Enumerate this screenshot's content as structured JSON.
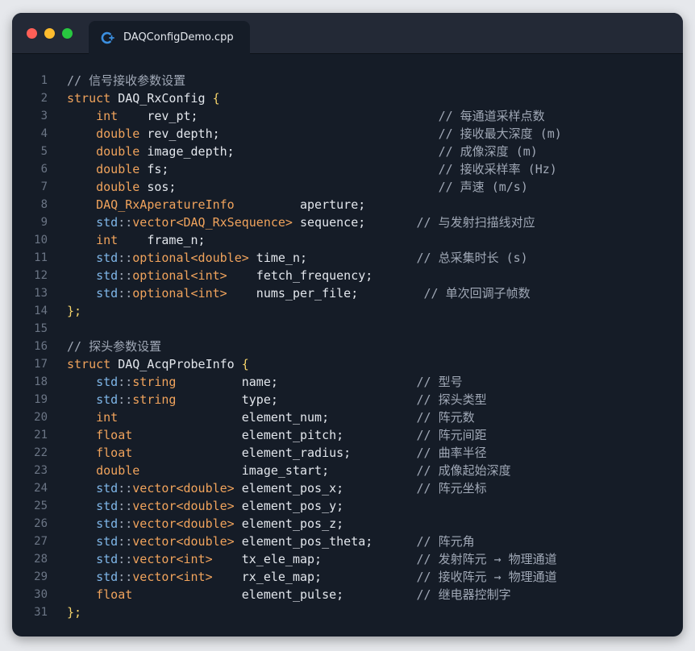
{
  "tab": {
    "title": "DAQConfigDemo.cpp",
    "icon": "cpp-file-icon"
  },
  "colors": {
    "background": "#151c27",
    "keyword": "#f0a35c",
    "namespace": "#7fb6e8",
    "comment": "#a0a8b6",
    "brace": "#f5d36a",
    "text": "#e2e6ec",
    "line_number": "#6b7585"
  },
  "lines": [
    [
      [
        "cm",
        "// 信号接收参数设置"
      ]
    ],
    [
      [
        "kw",
        "struct "
      ],
      [
        "id",
        "DAQ_RxConfig "
      ],
      [
        "br",
        "{"
      ]
    ],
    [
      [
        "id",
        "    "
      ],
      [
        "kw",
        "int"
      ],
      [
        "id",
        "    rev_pt;"
      ],
      [
        "id",
        "                                 "
      ],
      [
        "cm",
        "// 每通道采样点数"
      ]
    ],
    [
      [
        "id",
        "    "
      ],
      [
        "kw",
        "double"
      ],
      [
        "id",
        " rev_depth;"
      ],
      [
        "id",
        "                              "
      ],
      [
        "cm",
        "// 接收最大深度 (m)"
      ]
    ],
    [
      [
        "id",
        "    "
      ],
      [
        "kw",
        "double"
      ],
      [
        "id",
        " image_depth;"
      ],
      [
        "id",
        "                            "
      ],
      [
        "cm",
        "// 成像深度 (m)"
      ]
    ],
    [
      [
        "id",
        "    "
      ],
      [
        "kw",
        "double"
      ],
      [
        "id",
        " fs;"
      ],
      [
        "id",
        "                                     "
      ],
      [
        "cm",
        "// 接收采样率 (Hz)"
      ]
    ],
    [
      [
        "id",
        "    "
      ],
      [
        "kw",
        "double"
      ],
      [
        "id",
        " sos;"
      ],
      [
        "id",
        "                                    "
      ],
      [
        "cm",
        "// 声速 (m/s)"
      ]
    ],
    [
      [
        "id",
        "    "
      ],
      [
        "ty",
        "DAQ_RxAperatureInfo"
      ],
      [
        "id",
        "         aperture;"
      ]
    ],
    [
      [
        "id",
        "    "
      ],
      [
        "ns",
        "std"
      ],
      [
        "op",
        "::"
      ],
      [
        "ty",
        "vector<DAQ_RxSequence>"
      ],
      [
        "id",
        " sequence;"
      ],
      [
        "id",
        "       "
      ],
      [
        "cm",
        "// 与发射扫描线对应"
      ]
    ],
    [
      [
        "id",
        "    "
      ],
      [
        "kw",
        "int"
      ],
      [
        "id",
        "    frame_n;"
      ]
    ],
    [
      [
        "id",
        "    "
      ],
      [
        "ns",
        "std"
      ],
      [
        "op",
        "::"
      ],
      [
        "ty",
        "optional<double>"
      ],
      [
        "id",
        " time_n;"
      ],
      [
        "id",
        "               "
      ],
      [
        "cm",
        "// 总采集时长 (s)"
      ]
    ],
    [
      [
        "id",
        "    "
      ],
      [
        "ns",
        "std"
      ],
      [
        "op",
        "::"
      ],
      [
        "ty",
        "optional<int>"
      ],
      [
        "id",
        "    fetch_frequency;"
      ]
    ],
    [
      [
        "id",
        "    "
      ],
      [
        "ns",
        "std"
      ],
      [
        "op",
        "::"
      ],
      [
        "ty",
        "optional<int>"
      ],
      [
        "id",
        "    nums_per_file;"
      ],
      [
        "id",
        "         "
      ],
      [
        "cm",
        "// 单次回调子帧数"
      ]
    ],
    [
      [
        "br",
        "};"
      ]
    ],
    [
      [
        "id",
        ""
      ]
    ],
    [
      [
        "cm",
        "// 探头参数设置"
      ]
    ],
    [
      [
        "kw",
        "struct "
      ],
      [
        "id",
        "DAQ_AcqProbeInfo "
      ],
      [
        "br",
        "{"
      ]
    ],
    [
      [
        "id",
        "    "
      ],
      [
        "ns",
        "std"
      ],
      [
        "op",
        "::"
      ],
      [
        "ty",
        "string"
      ],
      [
        "id",
        "         name;"
      ],
      [
        "id",
        "                   "
      ],
      [
        "cm",
        "// 型号"
      ]
    ],
    [
      [
        "id",
        "    "
      ],
      [
        "ns",
        "std"
      ],
      [
        "op",
        "::"
      ],
      [
        "ty",
        "string"
      ],
      [
        "id",
        "         type;"
      ],
      [
        "id",
        "                   "
      ],
      [
        "cm",
        "// 探头类型"
      ]
    ],
    [
      [
        "id",
        "    "
      ],
      [
        "kw",
        "int"
      ],
      [
        "id",
        "                 element_num;"
      ],
      [
        "id",
        "            "
      ],
      [
        "cm",
        "// 阵元数"
      ]
    ],
    [
      [
        "id",
        "    "
      ],
      [
        "kw",
        "float"
      ],
      [
        "id",
        "               element_pitch;"
      ],
      [
        "id",
        "          "
      ],
      [
        "cm",
        "// 阵元间距"
      ]
    ],
    [
      [
        "id",
        "    "
      ],
      [
        "kw",
        "float"
      ],
      [
        "id",
        "               element_radius;"
      ],
      [
        "id",
        "         "
      ],
      [
        "cm",
        "// 曲率半径"
      ]
    ],
    [
      [
        "id",
        "    "
      ],
      [
        "kw",
        "double"
      ],
      [
        "id",
        "              image_start;"
      ],
      [
        "id",
        "            "
      ],
      [
        "cm",
        "// 成像起始深度"
      ]
    ],
    [
      [
        "id",
        "    "
      ],
      [
        "ns",
        "std"
      ],
      [
        "op",
        "::"
      ],
      [
        "ty",
        "vector<double>"
      ],
      [
        "id",
        " element_pos_x;"
      ],
      [
        "id",
        "          "
      ],
      [
        "cm",
        "// 阵元坐标"
      ]
    ],
    [
      [
        "id",
        "    "
      ],
      [
        "ns",
        "std"
      ],
      [
        "op",
        "::"
      ],
      [
        "ty",
        "vector<double>"
      ],
      [
        "id",
        " element_pos_y;"
      ]
    ],
    [
      [
        "id",
        "    "
      ],
      [
        "ns",
        "std"
      ],
      [
        "op",
        "::"
      ],
      [
        "ty",
        "vector<double>"
      ],
      [
        "id",
        " element_pos_z;"
      ]
    ],
    [
      [
        "id",
        "    "
      ],
      [
        "ns",
        "std"
      ],
      [
        "op",
        "::"
      ],
      [
        "ty",
        "vector<double>"
      ],
      [
        "id",
        " element_pos_theta;"
      ],
      [
        "id",
        "      "
      ],
      [
        "cm",
        "// 阵元角"
      ]
    ],
    [
      [
        "id",
        "    "
      ],
      [
        "ns",
        "std"
      ],
      [
        "op",
        "::"
      ],
      [
        "ty",
        "vector<int>"
      ],
      [
        "id",
        "    tx_ele_map;"
      ],
      [
        "id",
        "             "
      ],
      [
        "cm",
        "// 发射阵元 → 物理通道"
      ]
    ],
    [
      [
        "id",
        "    "
      ],
      [
        "ns",
        "std"
      ],
      [
        "op",
        "::"
      ],
      [
        "ty",
        "vector<int>"
      ],
      [
        "id",
        "    rx_ele_map;"
      ],
      [
        "id",
        "             "
      ],
      [
        "cm",
        "// 接收阵元 → 物理通道"
      ]
    ],
    [
      [
        "id",
        "    "
      ],
      [
        "kw",
        "float"
      ],
      [
        "id",
        "               element_pulse;"
      ],
      [
        "id",
        "          "
      ],
      [
        "cm",
        "// 继电器控制字"
      ]
    ],
    [
      [
        "br",
        "};"
      ]
    ]
  ]
}
